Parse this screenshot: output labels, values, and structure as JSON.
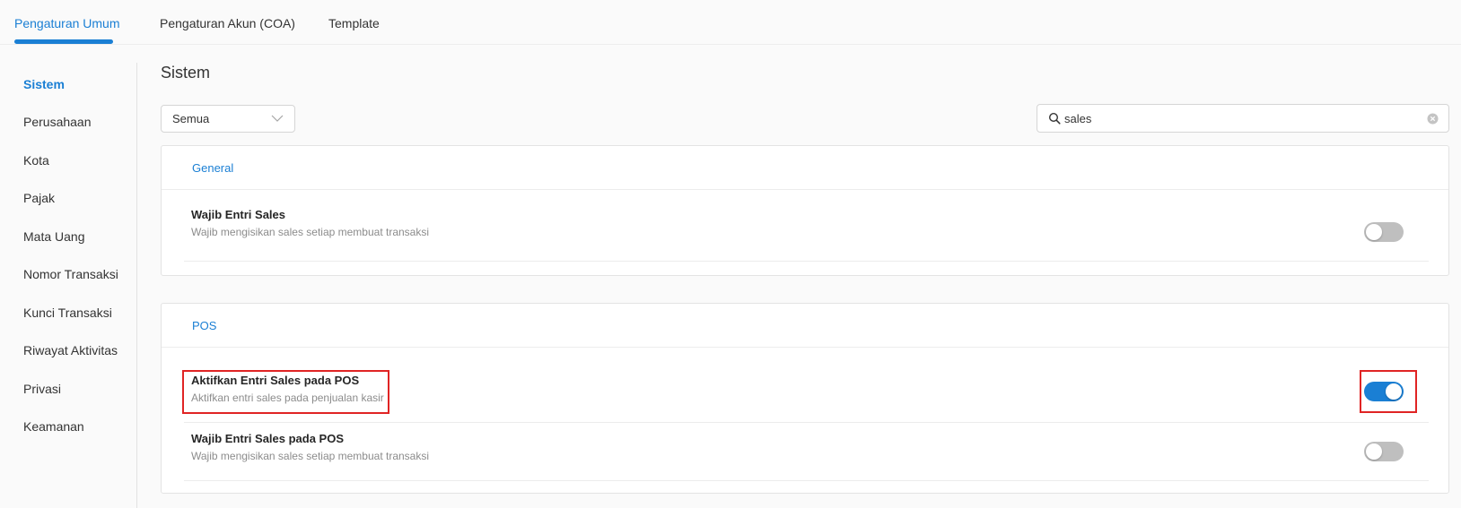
{
  "tabs": [
    {
      "label": "Pengaturan Umum",
      "active": true
    },
    {
      "label": "Pengaturan Akun (COA)",
      "active": false
    },
    {
      "label": "Template",
      "active": false
    }
  ],
  "sidebar": {
    "items": [
      {
        "label": "Sistem",
        "active": true
      },
      {
        "label": "Perusahaan"
      },
      {
        "label": "Kota"
      },
      {
        "label": "Pajak"
      },
      {
        "label": "Mata Uang"
      },
      {
        "label": "Nomor Transaksi"
      },
      {
        "label": "Kunci Transaksi"
      },
      {
        "label": "Riwayat Aktivitas"
      },
      {
        "label": "Privasi"
      },
      {
        "label": "Keamanan"
      }
    ]
  },
  "main": {
    "title": "Sistem",
    "filter": {
      "selected": "Semua"
    },
    "search": {
      "value": "sales"
    }
  },
  "sections": [
    {
      "title": "General",
      "settings": [
        {
          "title": "Wajib Entri Sales",
          "description": "Wajib mengisikan sales setiap membuat transaksi",
          "enabled": false
        }
      ]
    },
    {
      "title": "POS",
      "settings": [
        {
          "title": "Aktifkan Entri Sales pada POS",
          "description": "Aktifkan entri sales pada penjualan kasir",
          "enabled": true,
          "highlighted": true
        },
        {
          "title": "Wajib Entri Sales pada POS",
          "description": "Wajib mengisikan sales setiap membuat transaksi",
          "enabled": false
        }
      ]
    }
  ],
  "colors": {
    "accent": "#1a7fd4",
    "toggle_off": "#bfbfbf",
    "highlight": "#e02424"
  }
}
